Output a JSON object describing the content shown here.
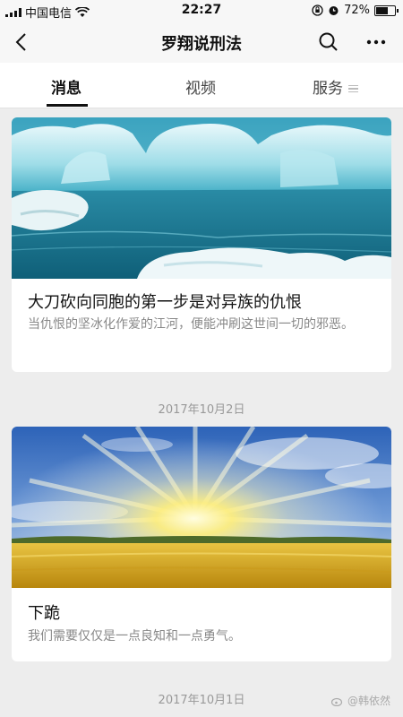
{
  "status_bar": {
    "carrier": "中国电信",
    "time": "22:27",
    "battery": "72%",
    "battery_level": 0.72
  },
  "nav": {
    "title": "罗翔说刑法",
    "icons": [
      "back-icon",
      "search-icon",
      "more-icon"
    ]
  },
  "tabs": [
    {
      "label": "消息",
      "active": true
    },
    {
      "label": "视频",
      "active": false
    },
    {
      "label": "服务",
      "active": false
    }
  ],
  "articles": [
    {
      "title": "大刀砍向同胞的第一步是对异族的仇恨",
      "description": "当仇恨的坚冰化作爱的江河，便能冲刷这世间一切的邪恶。",
      "image": "iceberg-photo"
    },
    {
      "date": "2017年10月2日",
      "title": "下跪",
      "description": "我们需要仅仅是一点良知和一点勇气。",
      "image": "sunrise-field-photo"
    }
  ],
  "footer_date": "2017年10月1日",
  "watermark": "@韩依然"
}
